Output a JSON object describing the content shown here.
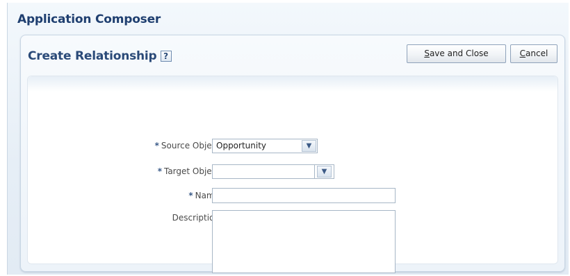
{
  "app": {
    "title": "Application Composer"
  },
  "dialog": {
    "title": "Create Relationship",
    "help_glyph": "?",
    "buttons": {
      "save_close_prefix": "S",
      "save_close_rest": "ave and Close",
      "cancel_prefix": "C",
      "cancel_rest": "ancel"
    }
  },
  "form": {
    "required_marker": "*",
    "source_object": {
      "label": "Source Object",
      "value": "Opportunity"
    },
    "target_object": {
      "label": "Target Object",
      "value": ""
    },
    "name": {
      "label": "Name",
      "value": ""
    },
    "description": {
      "label": "Description",
      "value": ""
    }
  },
  "icons": {
    "dropdown": "chevron-down-icon",
    "help": "help-icon"
  },
  "colors": {
    "title": "#1f3f70",
    "accent": "#2a4a78"
  }
}
